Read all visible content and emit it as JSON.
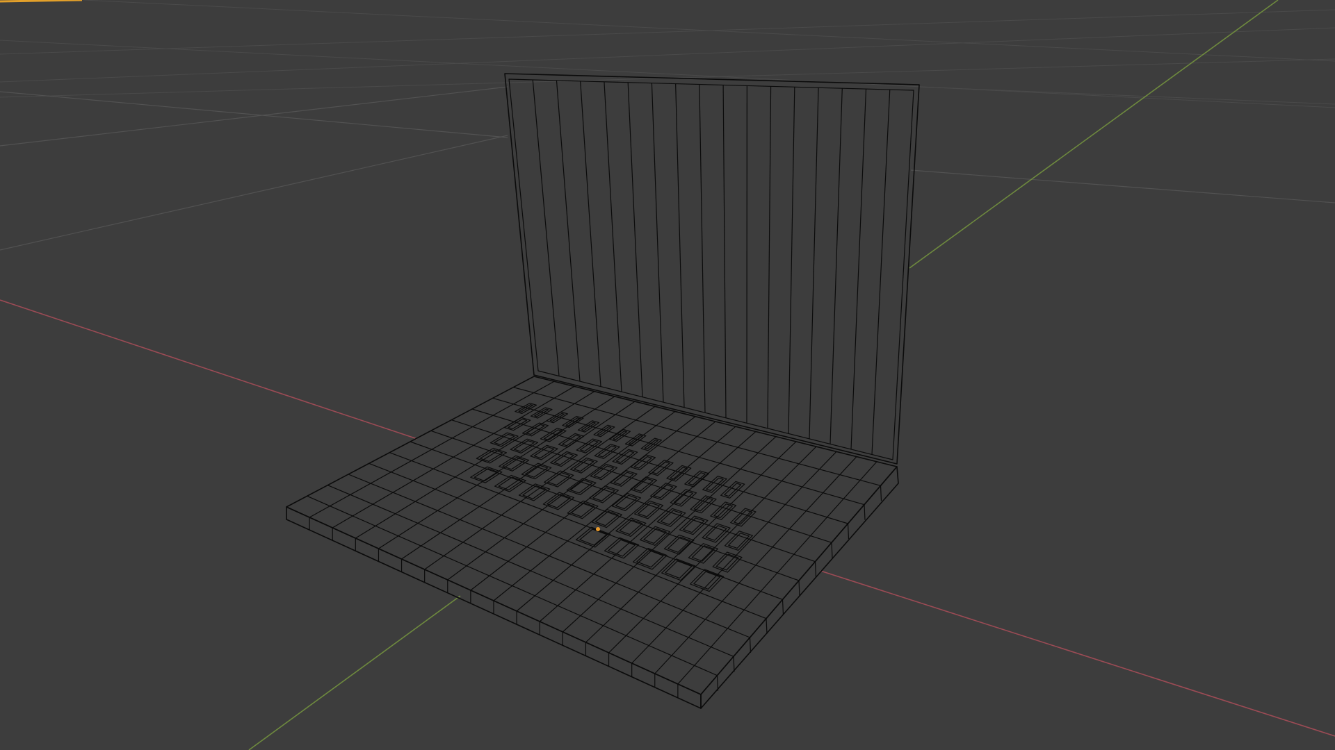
{
  "viewport": {
    "mode": "wireframe",
    "object": "laptop-mesh",
    "colors": {
      "background": "#3d3d3d",
      "grid": "#4a4a4a",
      "x_axis": "#9c4b55",
      "y_axis": "#6e8a3e",
      "wire": "#0b0b0b",
      "origin": "#e89a2c",
      "active_corner": "#e3a02a"
    },
    "icons": {
      "origin": "object-origin-icon"
    }
  }
}
